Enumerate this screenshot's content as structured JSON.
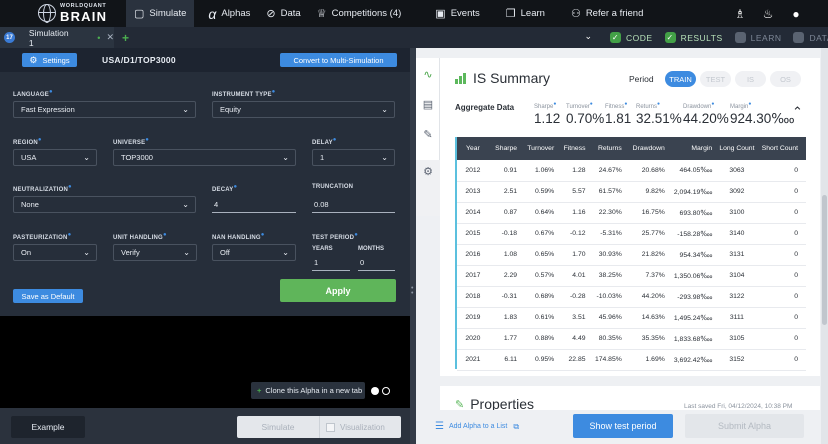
{
  "nav": {
    "logo_top": "WORLDQUANT",
    "logo_bottom": "BRAIN",
    "items": [
      {
        "label": "Simulate",
        "icon": "simulate-icon",
        "glyph": "▢"
      },
      {
        "label": "Alphas",
        "icon": "alpha-icon",
        "glyph": "α"
      },
      {
        "label": "Data",
        "icon": "data-icon",
        "glyph": "⊘"
      },
      {
        "label": "Competitions (4)",
        "icon": "trophy-icon",
        "glyph": "♕"
      },
      {
        "label": "Events",
        "icon": "events-icon",
        "glyph": "▣"
      },
      {
        "label": "Learn",
        "icon": "book-icon",
        "glyph": "❐"
      },
      {
        "label": "Refer a friend",
        "icon": "refer-icon",
        "glyph": "⚇"
      }
    ]
  },
  "tabs": {
    "items": [
      {
        "label": "Simulation 1",
        "badge": "17"
      }
    ]
  },
  "view_toggles": [
    {
      "label": "CODE",
      "checked": true
    },
    {
      "label": "RESULTS",
      "checked": true
    },
    {
      "label": "LEARN",
      "checked": false
    },
    {
      "label": "DATA",
      "checked": false
    }
  ],
  "settings": {
    "settings_label": "Settings",
    "combo": "USA/D1/TOP3000",
    "convert_label": "Convert to Multi-Simulation",
    "language": {
      "label": "LANGUAGE",
      "value": "Fast Expression"
    },
    "instrument_type": {
      "label": "INSTRUMENT TYPE",
      "value": "Equity"
    },
    "region": {
      "label": "REGION",
      "value": "USA"
    },
    "universe": {
      "label": "UNIVERSE",
      "value": "TOP3000"
    },
    "delay": {
      "label": "DELAY",
      "value": "1"
    },
    "neutralization": {
      "label": "NEUTRALIZATION",
      "value": "None"
    },
    "decay": {
      "label": "DECAY",
      "value": "4"
    },
    "truncation": {
      "label": "TRUNCATION",
      "value": "0.08"
    },
    "pasteurization": {
      "label": "PASTEURIZATION",
      "value": "On"
    },
    "unit_handling": {
      "label": "UNIT HANDLING",
      "value": "Verify"
    },
    "nan_handling": {
      "label": "NAN HANDLING",
      "value": "Off"
    },
    "test_period": {
      "label": "TEST PERIOD",
      "years_label": "YEARS",
      "years": "1",
      "months_label": "MONTHS",
      "months": "0"
    },
    "save_default_label": "Save as Default",
    "apply_label": "Apply"
  },
  "editor": {
    "clone_label": "Clone this Alpha in a new tab"
  },
  "bottom": {
    "example_label": "Example",
    "simulate_label": "Simulate",
    "visualization_label": "Visualization"
  },
  "summary": {
    "title": "IS Summary",
    "period_label": "Period",
    "periods": [
      {
        "label": "TRAIN",
        "active": true
      },
      {
        "label": "TEST",
        "active": false
      },
      {
        "label": "IS",
        "active": false
      },
      {
        "label": "OS",
        "active": false
      }
    ],
    "aggregate_label": "Aggregate Data",
    "metrics": [
      {
        "label": "Sharpe",
        "value": "1.12"
      },
      {
        "label": "Turnover",
        "value": "0.70%"
      },
      {
        "label": "Fitness",
        "value": "1.81"
      },
      {
        "label": "Returns",
        "value": "32.51%"
      },
      {
        "label": "Drawdown",
        "value": "44.20%"
      },
      {
        "label": "Margin",
        "value": "924.30‱"
      }
    ],
    "columns": [
      "Year",
      "Sharpe",
      "Turnover",
      "Fitness",
      "Returns",
      "Drawdown",
      "Margin",
      "Long Count",
      "Short Count"
    ],
    "rows": [
      [
        "2012",
        "0.91",
        "1.06%",
        "1.28",
        "24.67%",
        "20.68%",
        "464.05‱",
        "3063",
        "0"
      ],
      [
        "2013",
        "2.51",
        "0.59%",
        "5.57",
        "61.57%",
        "9.82%",
        "2,094.19‱",
        "3092",
        "0"
      ],
      [
        "2014",
        "0.87",
        "0.64%",
        "1.16",
        "22.30%",
        "16.75%",
        "693.80‱",
        "3100",
        "0"
      ],
      [
        "2015",
        "-0.18",
        "0.67%",
        "-0.12",
        "-5.31%",
        "25.77%",
        "-158.28‱",
        "3140",
        "0"
      ],
      [
        "2016",
        "1.08",
        "0.65%",
        "1.70",
        "30.93%",
        "21.82%",
        "954.34‱",
        "3131",
        "0"
      ],
      [
        "2017",
        "2.29",
        "0.57%",
        "4.01",
        "38.25%",
        "7.37%",
        "1,350.06‱",
        "3104",
        "0"
      ],
      [
        "2018",
        "-0.31",
        "0.68%",
        "-0.28",
        "-10.03%",
        "44.20%",
        "-293.98‱",
        "3122",
        "0"
      ],
      [
        "2019",
        "1.83",
        "0.61%",
        "3.51",
        "45.96%",
        "14.63%",
        "1,495.24‱",
        "3111",
        "0"
      ],
      [
        "2020",
        "1.77",
        "0.88%",
        "4.49",
        "80.35%",
        "35.35%",
        "1,833.68‱",
        "3105",
        "0"
      ],
      [
        "2021",
        "6.11",
        "0.95%",
        "22.85",
        "174.85%",
        "1.69%",
        "3,692.42‱",
        "3152",
        "0"
      ]
    ]
  },
  "properties": {
    "title": "Properties",
    "last_saved": "Last saved Fri, 04/12/2024, 10:38 PM"
  },
  "actions": {
    "add_list_label": "Add Alpha to a List",
    "show_test_label": "Show test period",
    "submit_label": "Submit Alpha"
  },
  "colors": {
    "accent": "#3d8be0",
    "apply_green": "#5fb55a",
    "nav_bg": "#111418",
    "panel_bg": "#262e3a"
  }
}
